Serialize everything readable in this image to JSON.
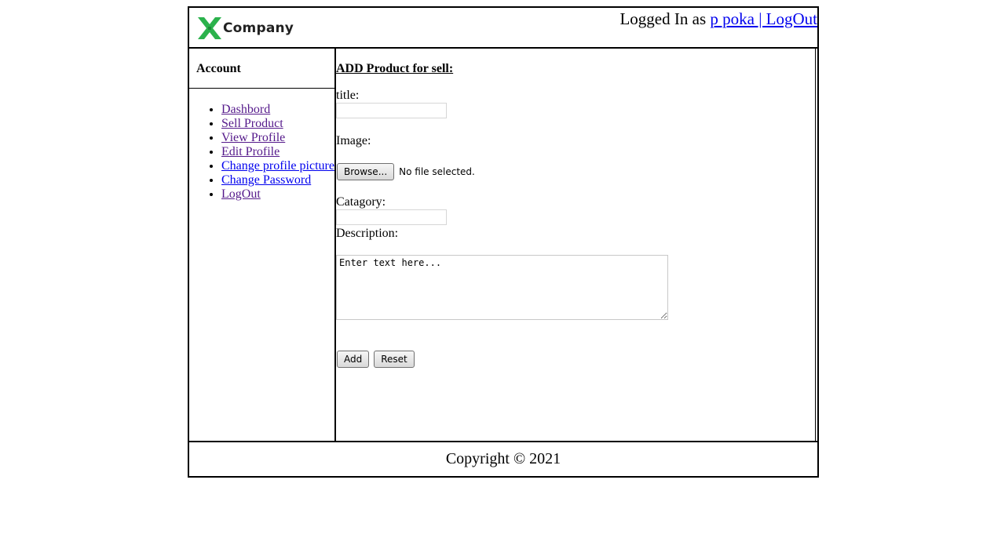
{
  "header": {
    "logo_text": "Company",
    "logged_in_prefix": "Logged In as ",
    "username": "p poka",
    "logout_link": " | LogOut"
  },
  "sidebar": {
    "title": "Account",
    "items": [
      {
        "label": "Dashbord",
        "visited": true
      },
      {
        "label": "Sell Product",
        "visited": true
      },
      {
        "label": "View Profile",
        "visited": true
      },
      {
        "label": "Edit Profile",
        "visited": true
      },
      {
        "label": "Change profile picture",
        "visited": false
      },
      {
        "label": "Change Password",
        "visited": false
      },
      {
        "label": "LogOut",
        "visited": true
      }
    ]
  },
  "form": {
    "title": "ADD Product for sell:",
    "title_label": "title:",
    "title_value": "",
    "image_label": "Image:",
    "browse_label": "Browse...",
    "file_status": "No file selected.",
    "category_label": "Catagory:",
    "category_value": "",
    "description_label": "Description:",
    "description_value": "Enter text here...",
    "add_label": "Add",
    "reset_label": "Reset"
  },
  "footer": {
    "copyright": "Copyright © 2021"
  },
  "colors": {
    "logo_green": "#2bb24c",
    "link_unvisited": "#0000ee",
    "link_visited": "#551a8b"
  }
}
